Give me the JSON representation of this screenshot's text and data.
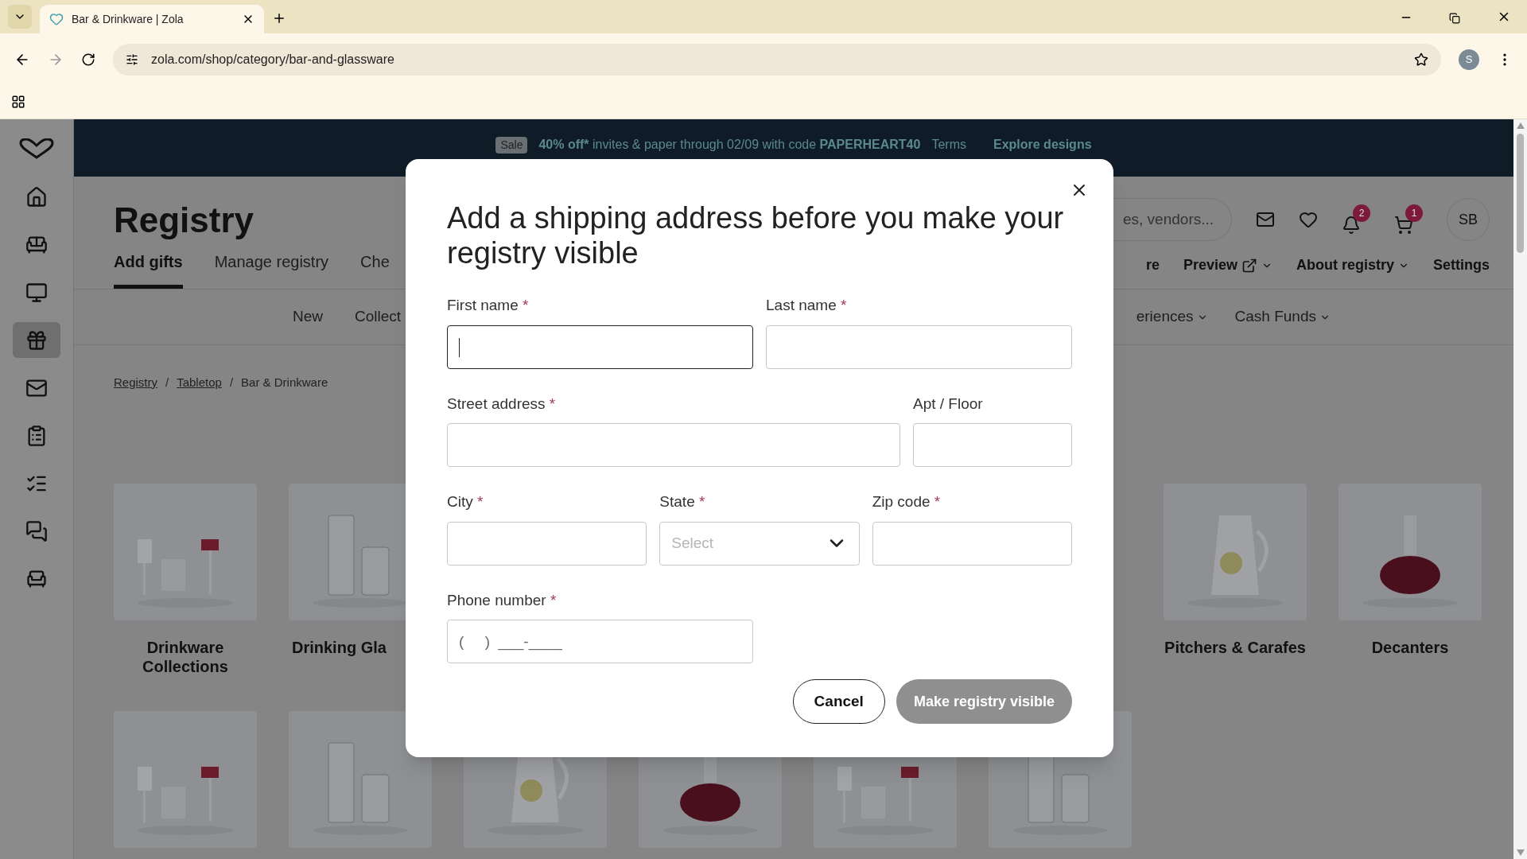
{
  "browser": {
    "tab_title": "Bar & Drinkware | Zola",
    "url": "zola.com/shop/category/bar-and-glassware",
    "profile_initial": "S"
  },
  "sidebar": {
    "items": [
      {
        "selected": false
      },
      {
        "selected": false
      },
      {
        "selected": false
      },
      {
        "selected": true
      },
      {
        "selected": false
      },
      {
        "selected": false
      },
      {
        "selected": false
      },
      {
        "selected": false
      },
      {
        "selected": false
      }
    ]
  },
  "banner": {
    "badge": "Sale",
    "highlight": "40% off*",
    "text": "invites & paper through 02/09 with code",
    "code": "PAPERHEART40",
    "terms": "Terms",
    "cta": "Explore designs"
  },
  "header": {
    "title": "Registry",
    "search": {
      "placeholder": "es, vendors..."
    },
    "notifications_count": "2",
    "cart_count": "1",
    "avatar": "SB",
    "tabs": [
      {
        "label": "Add gifts",
        "selected": true
      },
      {
        "label": "Manage registry",
        "selected": false
      },
      {
        "label": "Che",
        "selected": false
      }
    ],
    "right_tabs": [
      {
        "label": "re",
        "kind": "plain"
      },
      {
        "label": "Preview",
        "kind": "external"
      },
      {
        "label": "About registry",
        "kind": "dropdown"
      },
      {
        "label": "Settings",
        "kind": "plain"
      }
    ]
  },
  "subnav": {
    "left": [
      {
        "label": "New",
        "dropdown": false
      },
      {
        "label": "Collect",
        "dropdown": false
      }
    ],
    "right": [
      {
        "label": "eriences",
        "dropdown": true
      },
      {
        "label": "Cash Funds",
        "dropdown": true
      }
    ]
  },
  "breadcrumbs": [
    {
      "label": "Registry",
      "current": false
    },
    {
      "separator": "/",
      "label": "Tabletop",
      "current": false
    },
    {
      "separator": "/",
      "label": "Bar & Drinkware",
      "current": true
    }
  ],
  "categories": {
    "left": [
      {
        "label": "Drinkware Collections",
        "kind": "picture"
      },
      {
        "label": "Drinking Gla",
        "kind": "picture"
      }
    ],
    "right": [
      {
        "label": "Pitchers & Carafes",
        "kind": "picture"
      },
      {
        "label": "Decanters",
        "kind": "picture"
      }
    ]
  },
  "modal": {
    "title": "Add a shipping address before you make your registry visible",
    "rows": [
      [
        {
          "label": "First name",
          "required_mark": "*",
          "kind": "text",
          "focused": true
        },
        {
          "label": "Last name",
          "required_mark": "*",
          "kind": "text",
          "focused": false
        }
      ],
      [
        {
          "label": "Street address",
          "required_mark": "*",
          "kind": "text",
          "focused": false
        },
        {
          "label": "Apt / Floor",
          "kind": "text",
          "focused": false
        }
      ],
      [
        {
          "label": "City",
          "required_mark": "*",
          "kind": "text",
          "focused": false
        },
        {
          "label": "State",
          "required_mark": "*",
          "kind": "select",
          "placeholder": "Select",
          "focused": false
        },
        {
          "label": "Zip code",
          "required_mark": "*",
          "kind": "text",
          "focused": false
        }
      ],
      [
        {
          "label": "Phone number",
          "required_mark": "*",
          "kind": "text",
          "placeholder": "(     )  ___-____",
          "focused": false
        }
      ]
    ],
    "cancel": "Cancel",
    "submit": {
      "label": "Make registry visible",
      "disabled": true
    }
  }
}
